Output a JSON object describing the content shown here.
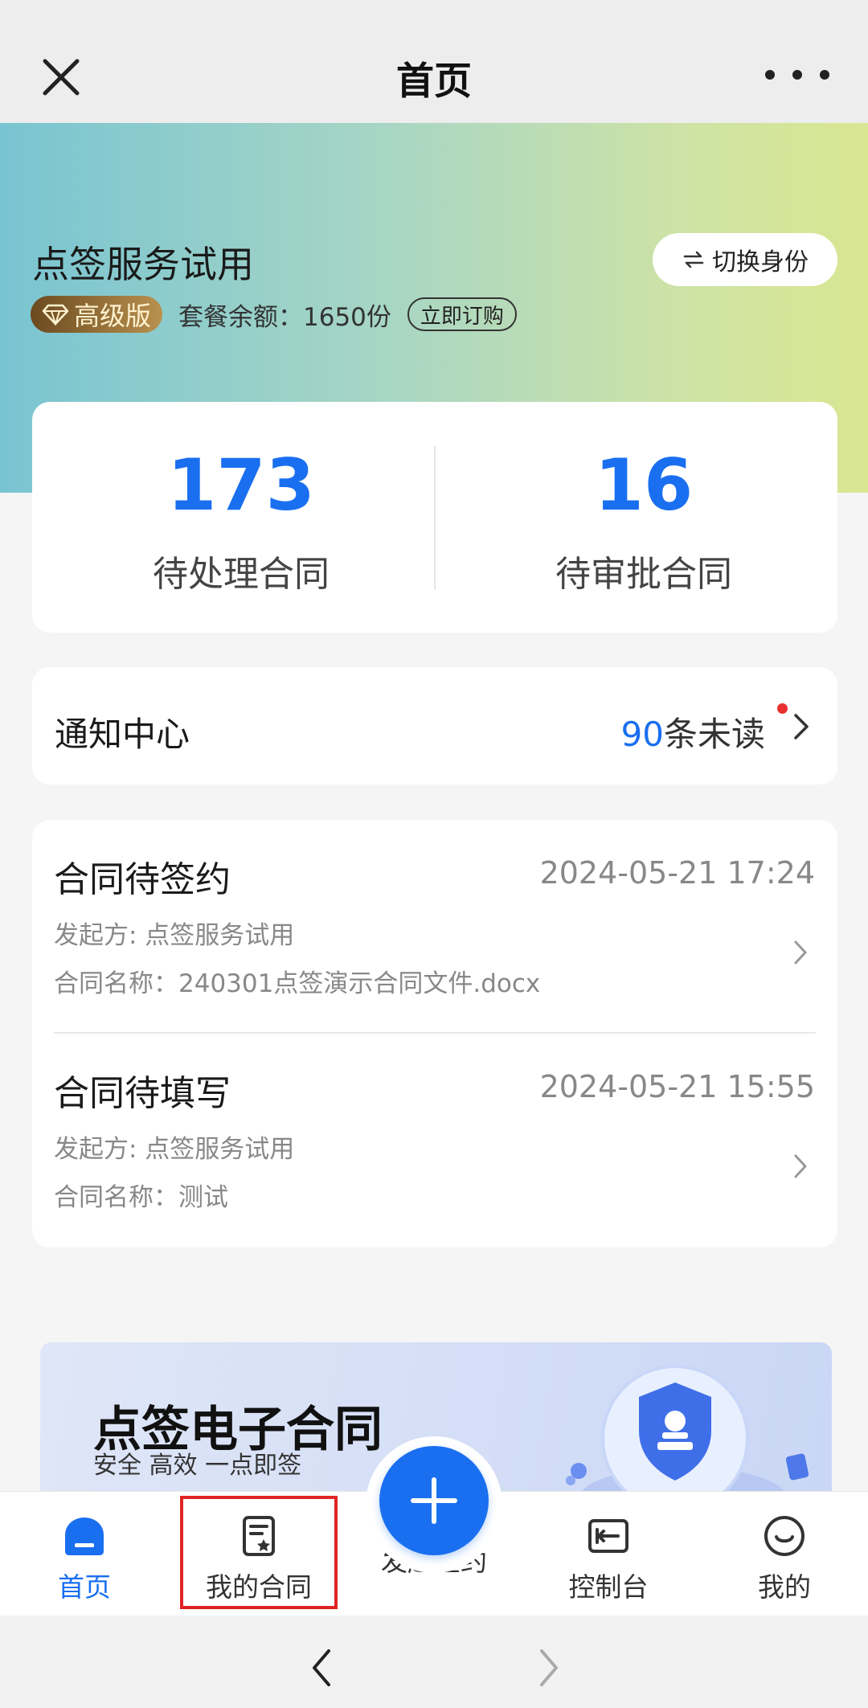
{
  "titlebar": {
    "title": "首页"
  },
  "hero": {
    "org_name": "点签服务试用",
    "switch_label": "切换身份",
    "tier": "高级版",
    "quota": "套餐余额：1650份",
    "buy_label": "立即订购"
  },
  "stats": {
    "pending_count": "173",
    "pending_label": "待处理合同",
    "approval_count": "16",
    "approval_label": "待审批合同"
  },
  "notify": {
    "title": "通知中心",
    "unread_count": "90",
    "unread_suffix": "条未读"
  },
  "tasks": [
    {
      "title": "合同待签约",
      "time": "2024-05-21 17:24",
      "initiator": "发起方:   点签服务试用",
      "contract": "合同名称：240301点签演示合同文件.docx"
    },
    {
      "title": "合同待填写",
      "time": "2024-05-21 15:55",
      "initiator": "发起方:   点签服务试用",
      "contract": "合同名称：测试"
    }
  ],
  "banner": {
    "title": "点签电子合同",
    "subtitle": "安全 高效 一点即签"
  },
  "tabbar": {
    "home": "首页",
    "my_contracts": "我的合同",
    "start_sign": "发起签约",
    "console": "控制台",
    "me": "我的"
  },
  "colors": {
    "accent": "#1a6ff0",
    "highlight": "#e02424",
    "tier_gold": "#b9914f"
  }
}
